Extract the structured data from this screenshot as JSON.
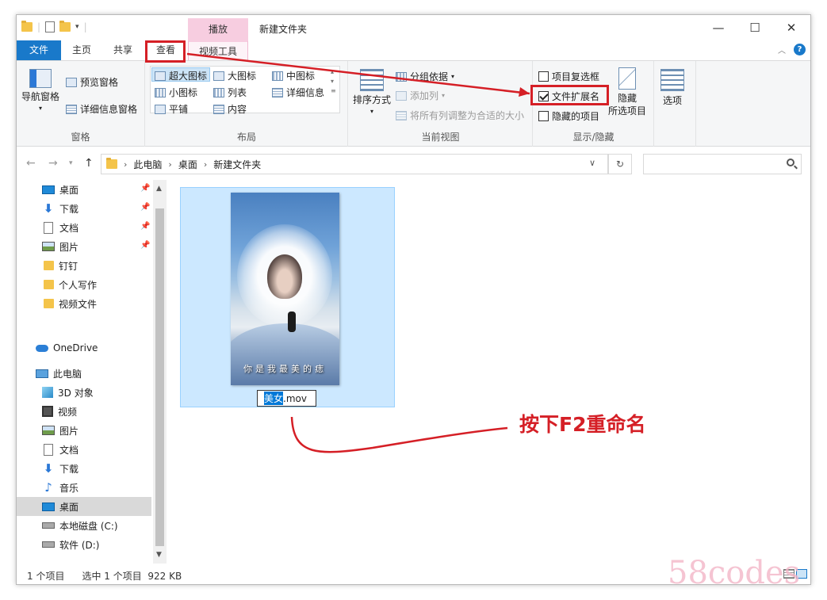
{
  "window": {
    "title": "新建文件夹",
    "context_tab_header": "播放",
    "controls": {
      "minimize": "—",
      "maximize": "☐",
      "close": "✕"
    }
  },
  "tabs": {
    "file": "文件",
    "home": "主页",
    "share": "共享",
    "view": "查看",
    "video_tools": "视频工具"
  },
  "ribbon": {
    "panes": {
      "nav_pane": "导航窗格",
      "preview_pane": "预览窗格",
      "details_pane": "详细信息窗格",
      "label": "窗格"
    },
    "layout": {
      "extra_large": "超大图标",
      "large": "大图标",
      "medium": "中图标",
      "small": "小图标",
      "list": "列表",
      "details": "详细信息",
      "tiles": "平铺",
      "content": "内容",
      "label": "布局",
      "selected": "超大图标"
    },
    "current_view": {
      "sort_by": "排序方式",
      "group_by": "分组依据",
      "add_column": "添加列",
      "size_all_columns": "将所有列调整为合适的大小",
      "label": "当前视图"
    },
    "show_hide": {
      "item_checkboxes": "项目复选框",
      "item_checkboxes_checked": false,
      "file_extensions": "文件扩展名",
      "file_extensions_checked": true,
      "hidden_items": "隐藏的项目",
      "hidden_items_checked": false,
      "hide_selected_1": "隐藏",
      "hide_selected_2": "所选项目",
      "label": "显示/隐藏"
    },
    "options": "选项"
  },
  "address": {
    "crumbs": [
      "此电脑",
      "桌面",
      "新建文件夹"
    ],
    "search_placeholder": ""
  },
  "nav": {
    "quick_access": [
      {
        "label": "桌面",
        "icon": "desktop-icon",
        "pinned": true
      },
      {
        "label": "下载",
        "icon": "download-icon",
        "pinned": true
      },
      {
        "label": "文档",
        "icon": "document-icon",
        "pinned": true
      },
      {
        "label": "图片",
        "icon": "picture-icon",
        "pinned": true
      },
      {
        "label": "钉钉",
        "icon": "folder-icon",
        "pinned": false
      },
      {
        "label": "个人写作",
        "icon": "folder-icon",
        "pinned": false
      },
      {
        "label": "视频文件",
        "icon": "folder-icon",
        "pinned": false
      }
    ],
    "onedrive": "OneDrive",
    "this_pc": "此电脑",
    "pc_items": [
      {
        "label": "3D 对象",
        "icon": "3d-objects-icon"
      },
      {
        "label": "视频",
        "icon": "video-icon"
      },
      {
        "label": "图片",
        "icon": "picture-icon"
      },
      {
        "label": "文档",
        "icon": "document-icon"
      },
      {
        "label": "下载",
        "icon": "download-icon"
      },
      {
        "label": "音乐",
        "icon": "music-icon"
      },
      {
        "label": "桌面",
        "icon": "desktop-icon"
      },
      {
        "label": "本地磁盘 (C:)",
        "icon": "drive-icon"
      },
      {
        "label": "软件 (D:)",
        "icon": "drive-icon"
      }
    ],
    "selected": "桌面"
  },
  "file": {
    "name_selected": "美女",
    "name_ext": ".mov",
    "thumbnail_caption": "你是我最美的痣"
  },
  "status": {
    "count": "1 个项目",
    "selected": "选中 1 个项目",
    "size": "922 KB"
  },
  "annotation": {
    "text": "按下F2重命名",
    "color": "#d51f26"
  },
  "watermark": "58codes"
}
